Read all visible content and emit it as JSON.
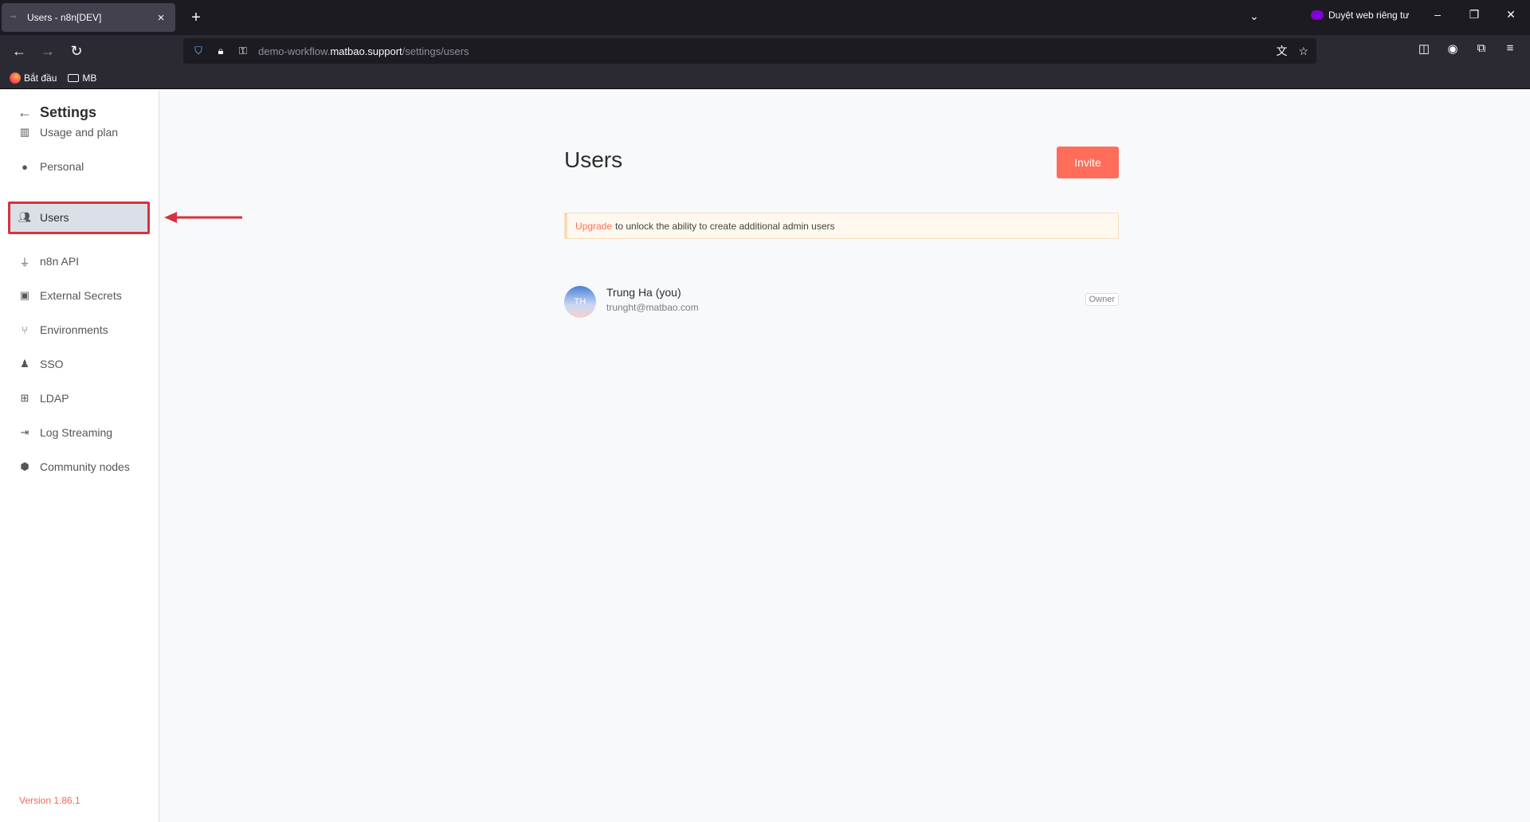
{
  "browser": {
    "tab_title": "Users - n8n[DEV]",
    "private_label": "Duyệt web riêng tư",
    "url_prefix": "demo-workflow.",
    "url_domain": "matbao.support",
    "url_path": "/settings/users",
    "bookmarks": [
      "Bắt đầu",
      "MB"
    ]
  },
  "sidebar": {
    "title": "Settings",
    "items": [
      {
        "label": "Usage and plan",
        "icon": "chart-icon"
      },
      {
        "label": "Personal",
        "icon": "user-circle-icon"
      },
      {
        "label": "Users",
        "icon": "users-icon"
      },
      {
        "label": "n8n API",
        "icon": "plug-icon"
      },
      {
        "label": "External Secrets",
        "icon": "vault-icon"
      },
      {
        "label": "Environments",
        "icon": "git-branch-icon"
      },
      {
        "label": "SSO",
        "icon": "user-lock-icon"
      },
      {
        "label": "LDAP",
        "icon": "network-icon"
      },
      {
        "label": "Log Streaming",
        "icon": "sign-in-icon"
      },
      {
        "label": "Community nodes",
        "icon": "cube-icon"
      }
    ],
    "active_item": "Users",
    "version": "Version 1.86.1"
  },
  "main": {
    "title": "Users",
    "invite_label": "Invite",
    "notice_link": "Upgrade",
    "notice_text": "to unlock the ability to create additional admin users",
    "users": [
      {
        "initials": "TH",
        "name": "Trung Ha (you)",
        "email": "trunght@matbao.com",
        "role": "Owner"
      }
    ]
  },
  "colors": {
    "accent": "#ff6d5a",
    "highlight": "#d8323e",
    "notice_bg": "#fff8ef"
  }
}
